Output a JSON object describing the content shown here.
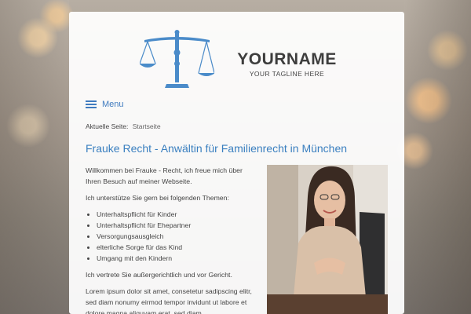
{
  "brand": {
    "name": "YOURNAME",
    "tagline": "YOUR TAGLINE HERE",
    "logo_icon": "scales-of-justice-icon",
    "accent_color": "#4a8bc9"
  },
  "nav": {
    "menu_label": "Menu",
    "menu_icon": "hamburger-icon"
  },
  "breadcrumb": {
    "prefix": "Aktuelle Seite:",
    "current": "Startseite"
  },
  "main": {
    "title": "Frauke Recht - Anwältin für Familienrecht in München",
    "intro": "Willkommen bei Frauke - Recht, ich freue mich über Ihren Besuch auf meiner Webseite.",
    "topics_intro": "Ich unterstütze Sie gern bei folgenden Themen:",
    "topics": [
      "Unterhaltspflicht für Kinder",
      "Unterhaltspflicht für Ehepartner",
      "Versorgungsausgleich",
      "elterliche Sorge für das Kind",
      "Umgang mit den Kindern"
    ],
    "representation": "Ich vertrete Sie außergerichtlich und vor Gericht.",
    "lorem": "Lorem ipsum dolor sit amet, consetetur sadipscing elitr, sed diam nonumy eirmod tempor invidunt ut labore et dolore magna aliquyam erat, sed diam"
  },
  "colors": {
    "link": "#3f7bbf",
    "text": "#444444",
    "brand_text": "#3d3d3d"
  }
}
